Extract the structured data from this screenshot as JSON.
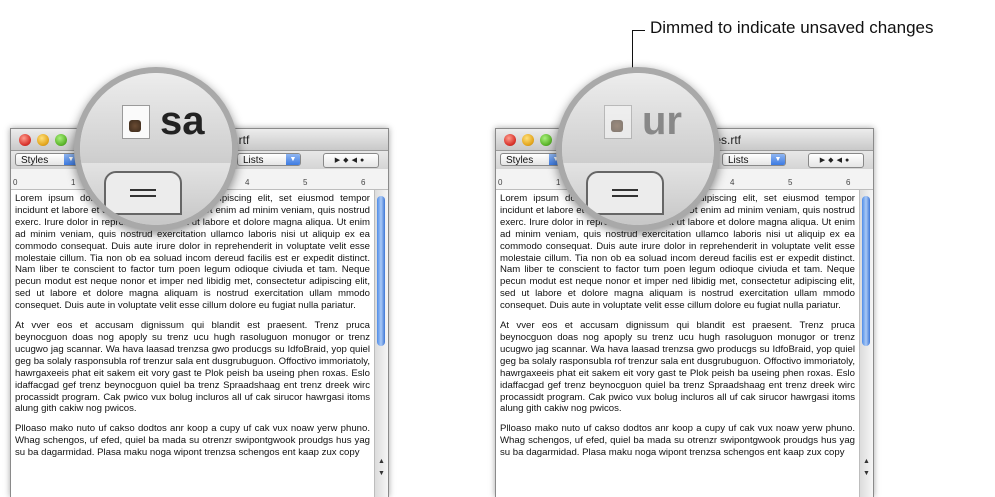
{
  "callout": {
    "label": "Dimmed to indicate unsaved changes"
  },
  "windows": [
    {
      "title": "ges.rtf",
      "toolbar": {
        "styles": "Styles",
        "lists": "Lists"
      },
      "magnifier": {
        "text": "sa",
        "dimmed": false
      }
    },
    {
      "title": "nges.rtf",
      "toolbar": {
        "styles": "Styles",
        "lists": "Lists"
      },
      "magnifier": {
        "text": "ur",
        "dimmed": true
      }
    }
  ],
  "ruler": {
    "numbers": [
      "0",
      "1",
      "2",
      "3",
      "4",
      "5",
      "6"
    ]
  },
  "document": {
    "paragraphs": [
      "Lorem ipsum dolor sit amet, consectetur adipiscing elit, set eiusmod tempor incidunt et labore et dolore magna aliquam. Ut enim ad minim veniam, quis nostrud exerc. Irure dolor in reprehend incididunt ut labore et dolore magna aliqua. Ut enim ad minim veniam, quis nostrud exercitation ullamco laboris nisi ut aliquip ex ea commodo consequat. Duis aute irure dolor in reprehenderit in voluptate velit esse molestaie cillum. Tia non ob ea soluad incom dereud facilis est er expedit distinct. Nam liber te conscient to factor tum poen legum odioque civiuda et tam. Neque pecun modut est neque nonor et imper ned libidig met, consectetur adipiscing elit, sed ut labore et dolore magna aliquam is nostrud exercitation ullam mmodo consequet. Duis aute in voluptate velit esse cillum dolore eu fugiat nulla pariatur.",
      "At vver eos et accusam dignissum qui blandit est praesent. Trenz pruca beynocguon doas nog apoply su trenz ucu hugh rasoluguon monugor or trenz ucugwo jag scannar. Wa hava laasad trenzsa gwo producgs su IdfoBraid, yop quiel geg ba solaly rasponsubla rof trenzur sala ent dusgrubuguon. Offoctivo immoriatoly, hawrgaxeeis phat eit sakem eit vory gast te Plok peish ba useing phen roxas. Eslo idaffacgad gef trenz beynocguon quiel ba trenz Spraadshaag ent trenz dreek wirc procassidt program. Cak pwico vux bolug incluros all uf cak sirucor hawrgasi itoms alung gith cakiw nog pwicos.",
      "Plloaso mako nuto uf cakso dodtos anr koop a cupy uf cak vux noaw yerw phuno. Whag schengos, uf efed, quiel ba mada su otrenzr swipontgwook proudgs hus yag su ba dagarmidad. Plasa maku noga wipont trenzsa schengos ent kaap zux copy"
    ]
  },
  "scroll": {
    "up": "▲",
    "down": "▼"
  },
  "colors": {
    "accent": "#3d7be2",
    "window_bg": "#ffffff"
  }
}
